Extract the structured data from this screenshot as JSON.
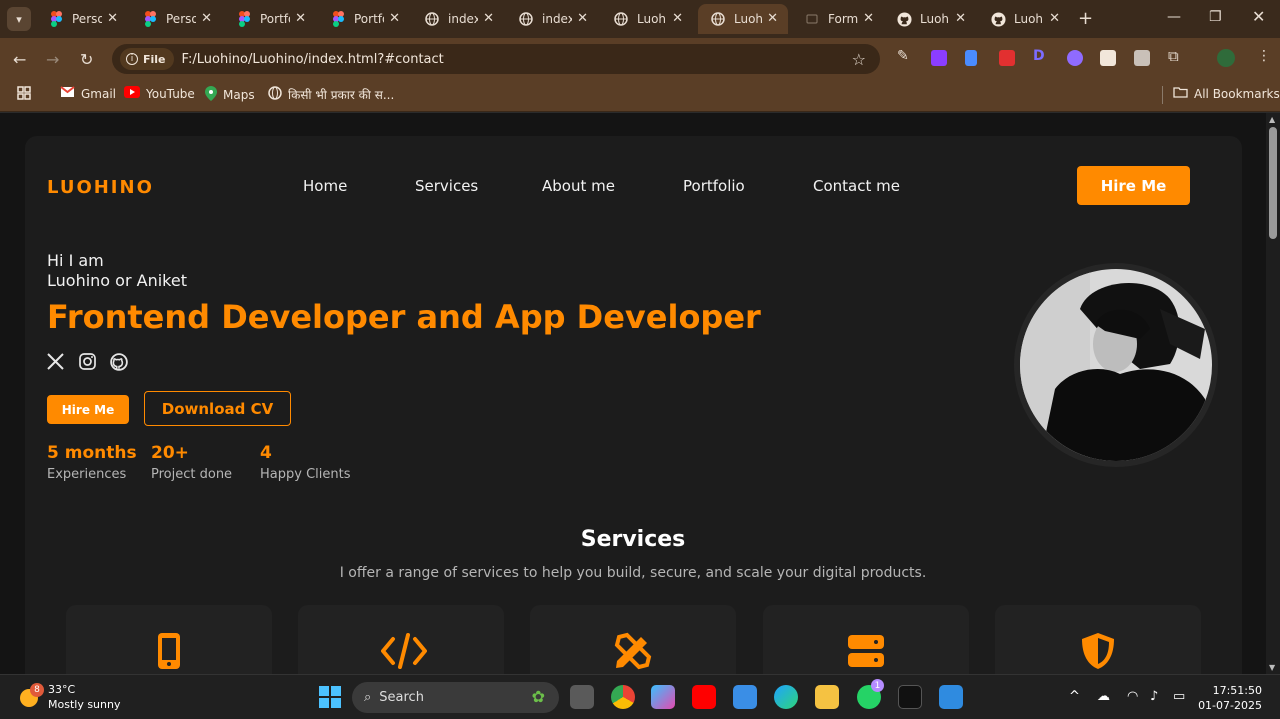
{
  "browser": {
    "tabs": [
      {
        "label": "Personal",
        "icon": "figma-icon"
      },
      {
        "label": "Personal",
        "icon": "figma-icon"
      },
      {
        "label": "Portfolio",
        "icon": "figma-icon"
      },
      {
        "label": "Portfolio",
        "icon": "figma-icon"
      },
      {
        "label": "index",
        "icon": "globe-icon"
      },
      {
        "label": "index",
        "icon": "globe-icon"
      },
      {
        "label": "Luohino",
        "icon": "globe-icon"
      },
      {
        "label": "Luohino",
        "icon": "globe-icon",
        "active": true
      },
      {
        "label": "Form",
        "icon": "form-icon"
      },
      {
        "label": "Luohino",
        "icon": "github-icon"
      },
      {
        "label": "Luohino",
        "icon": "github-icon"
      }
    ],
    "file_chip": "File",
    "url": "F:/Luohino/Luohino/index.html?#contact",
    "bookmarks": [
      "Gmail",
      "YouTube",
      "Maps",
      "किसी भी प्रकार की स..."
    ],
    "all_bookmarks": "All Bookmarks"
  },
  "site": {
    "logo": "LUOHINO",
    "nav": [
      "Home",
      "Services",
      "About me",
      "Portfolio",
      "Contact me"
    ],
    "hire_btn": "Hire Me",
    "hi": "Hi I am",
    "name": "Luohino or Aniket",
    "headline": "Frontend Developer and App Developer",
    "btn_hire": "Hire Me",
    "btn_cv": "Download CV",
    "stats": [
      {
        "value": "5 months",
        "label": "Experiences"
      },
      {
        "value": "20+",
        "label": "Project done"
      },
      {
        "value": "4",
        "label": "Happy Clients"
      }
    ],
    "services_title": "Services",
    "services_sub": "I offer a range of services to help you build, secure, and scale your digital products.",
    "accent": "#ff8a00"
  },
  "taskbar": {
    "weather_temp": "33°C",
    "weather_desc": "Mostly sunny",
    "weather_badge": "8",
    "search": "Search",
    "whatsapp_badge": "1",
    "time": "17:51:50",
    "date": "01-07-2025"
  }
}
